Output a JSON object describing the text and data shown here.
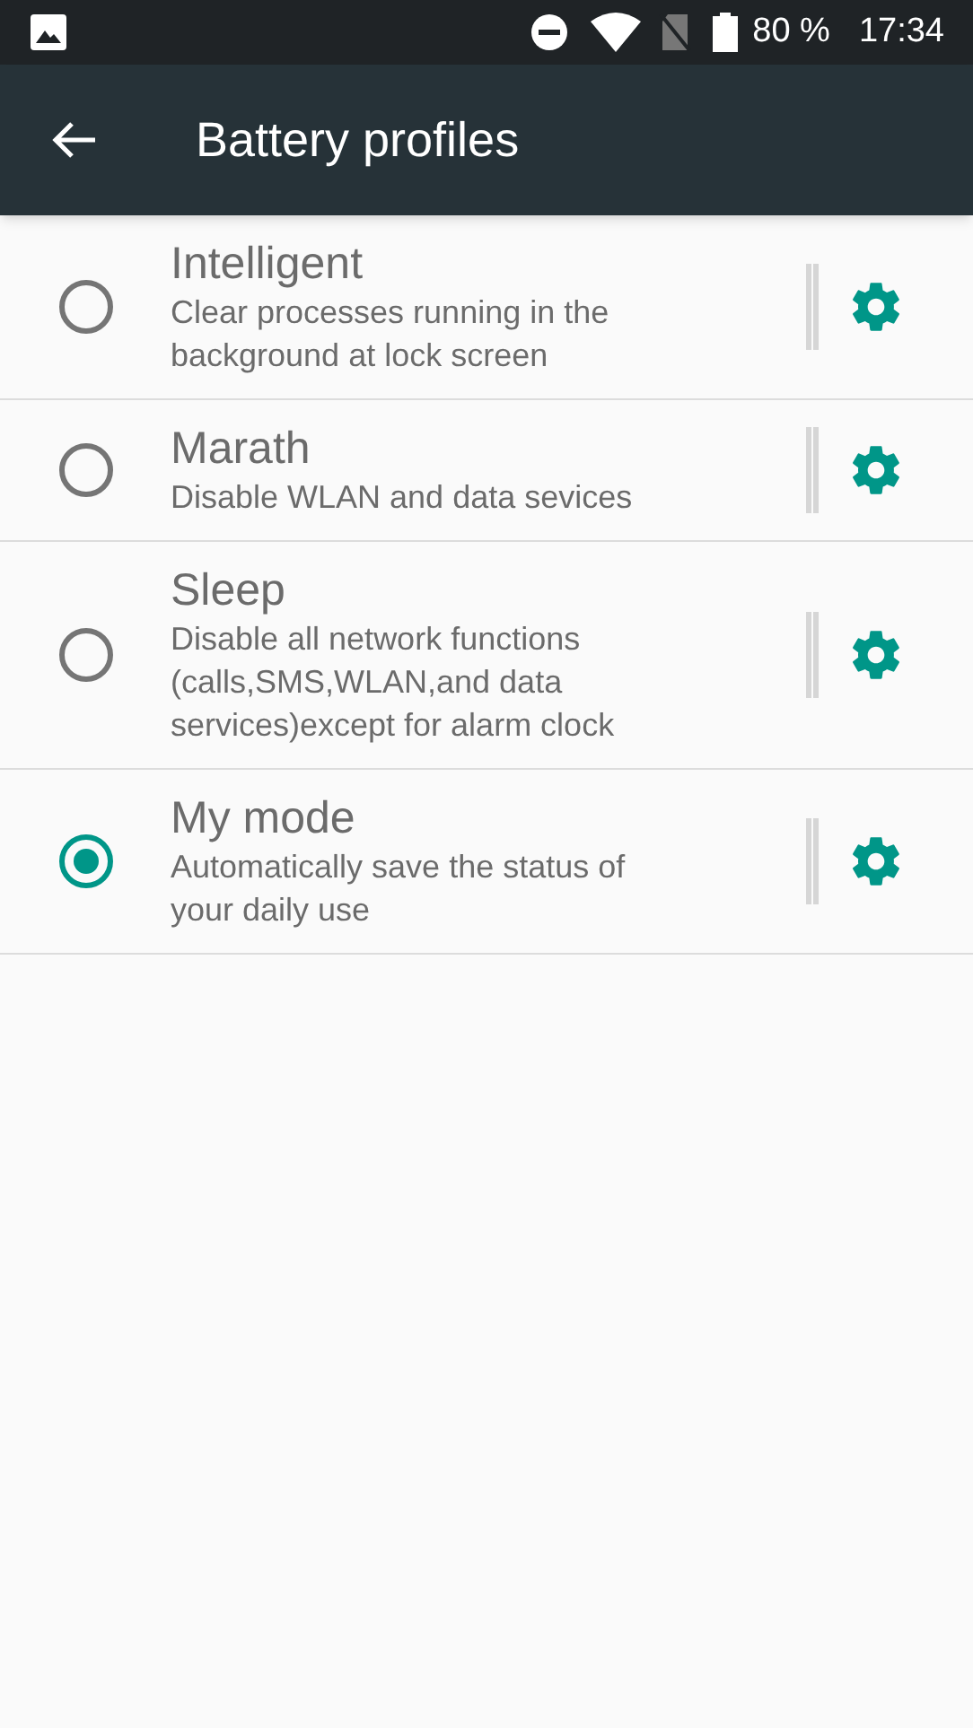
{
  "status_bar": {
    "battery": "80 %",
    "time": "17:34"
  },
  "app_bar": {
    "title": "Battery profiles"
  },
  "profiles": [
    {
      "title": "Intelligent",
      "description": "Clear processes running in the background at lock screen",
      "selected": false
    },
    {
      "title": "Marath",
      "description": "Disable WLAN and data sevices",
      "selected": false
    },
    {
      "title": "Sleep",
      "description": "Disable all network functions (calls,SMS,WLAN,and data services)except for alarm clock",
      "selected": false
    },
    {
      "title": "My mode",
      "description": "Automatically save the status of your daily use",
      "selected": true
    }
  ]
}
